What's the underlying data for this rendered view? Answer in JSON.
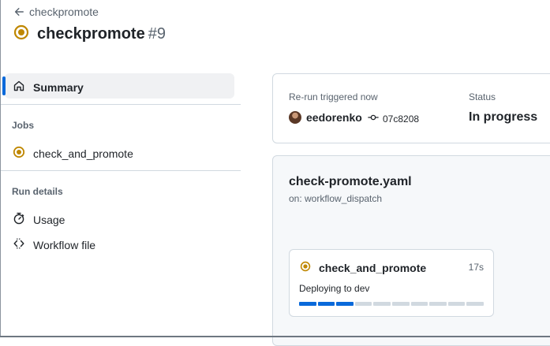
{
  "header": {
    "back_label": "checkpromote",
    "workflow_title": "checkpromote",
    "run_number": "#9"
  },
  "sidebar": {
    "summary_label": "Summary",
    "jobs_heading": "Jobs",
    "job_label": "check_and_promote",
    "run_details_heading": "Run details",
    "usage_label": "Usage",
    "workflow_file_label": "Workflow file"
  },
  "summary": {
    "trigger_label": "Re-run triggered now",
    "actor": "eedorenko",
    "commit": "07c8208",
    "status_label": "Status",
    "status_value": "In progress"
  },
  "workflow": {
    "file_name": "check-promote.yaml",
    "trigger": "on: workflow_dispatch",
    "job": {
      "name": "check_and_promote",
      "duration": "17s",
      "current_step": "Deploying to dev",
      "progress": {
        "segments_total": 10,
        "segments_done": 3
      }
    }
  },
  "colors": {
    "in_progress": "#bf8700",
    "accent": "#0969da",
    "muted": "#59636e"
  }
}
